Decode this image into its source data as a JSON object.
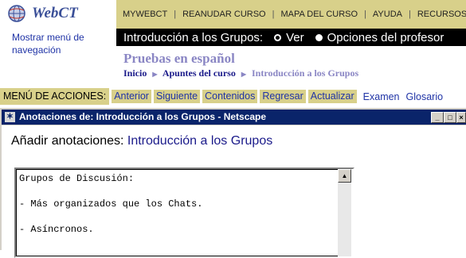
{
  "logo": {
    "text": "WebCT"
  },
  "show_nav": "Mostrar menú de navegación",
  "topnav": [
    "MYWEBCT",
    "REANUDAR CURSO",
    "MAPA DEL CURSO",
    "AYUDA",
    "RECURSOS"
  ],
  "blackbar": {
    "title": "Introducción a los Grupos:",
    "view_label": "Ver",
    "options_label": "Opciones del profesor"
  },
  "page_title": "Pruebas en español",
  "breadcrumb": {
    "home": "Inicio",
    "notes": "Apuntes del curso",
    "current": "Introducción a los Grupos"
  },
  "actions": {
    "label": "MENÚ DE ACCIONES:",
    "buttons": [
      "Anterior",
      "Siguiente",
      "Contenidos",
      "Regresar",
      "Actualizar"
    ],
    "links": [
      "Examen",
      "Glosario"
    ]
  },
  "window": {
    "title": "Anotaciones de: Introducción a los Grupos - Netscape",
    "heading_prefix": "Añadir anotaciones:",
    "heading_topic": "Introducción a los Grupos",
    "textarea": "Grupos de Discusión:\n\n- Más organizados que los Chats.\n\n- Asíncronos."
  },
  "colors": {
    "tan": "#d8d08a",
    "link": "#1f33a6",
    "titlebar": "#0a246a"
  }
}
